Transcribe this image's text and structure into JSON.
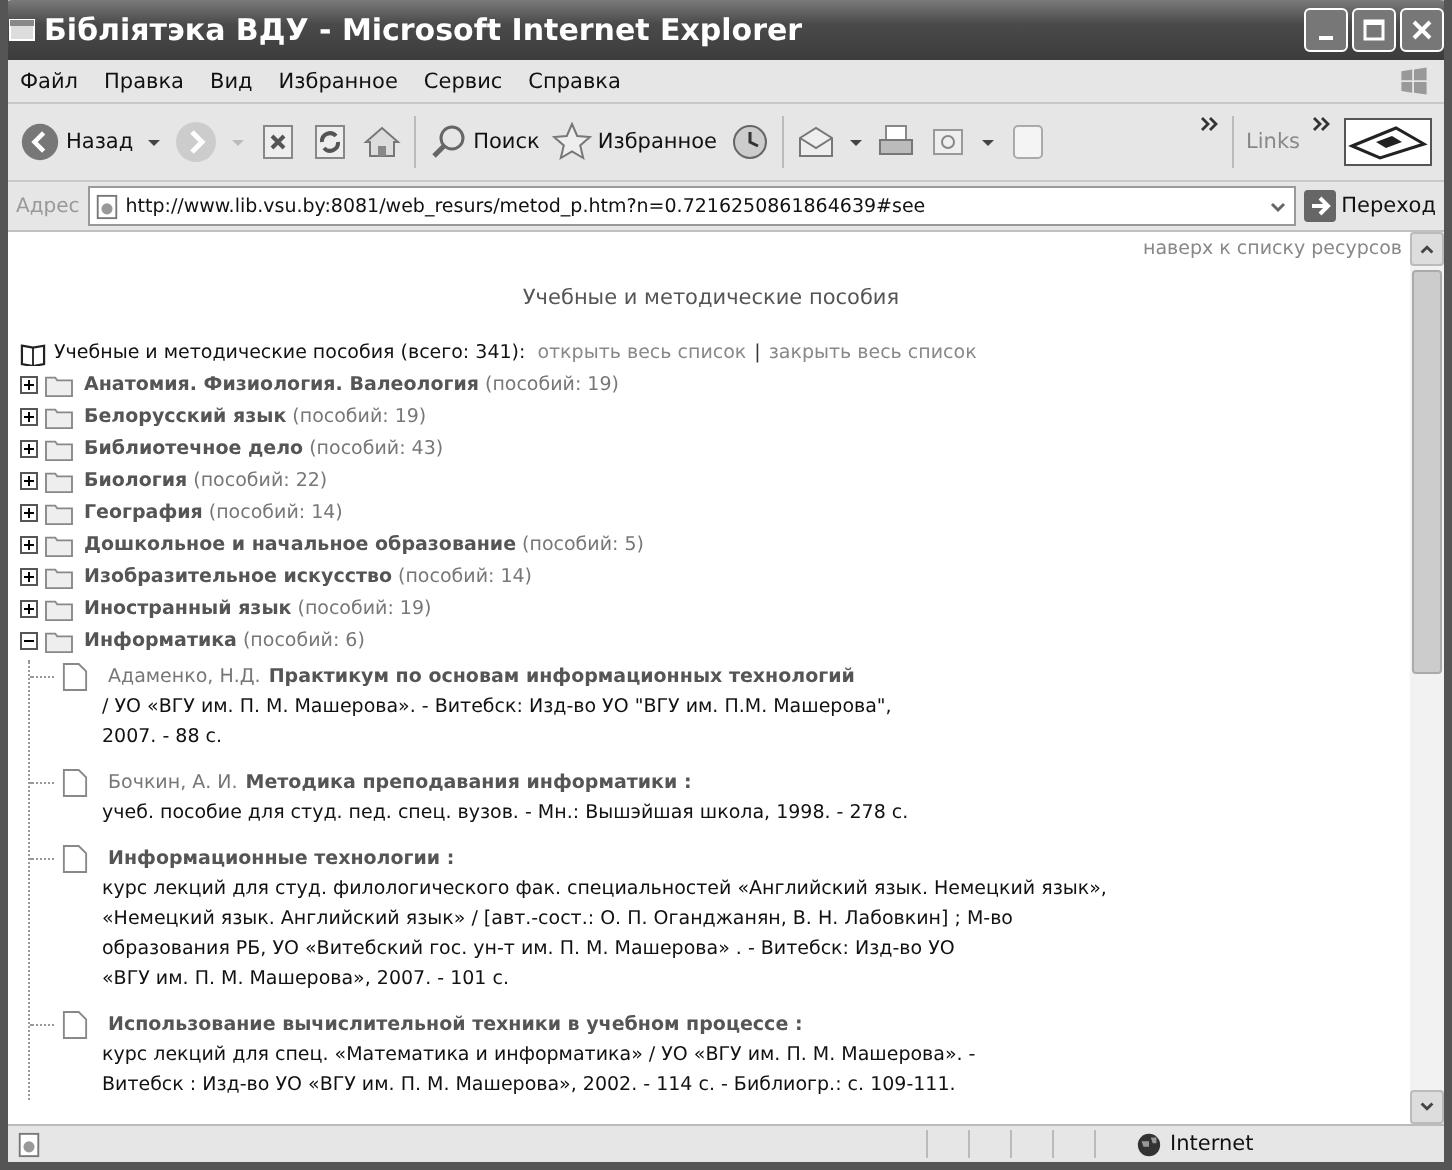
{
  "window": {
    "title": "Бібліятэка ВДУ - Microsoft Internet Explorer"
  },
  "menu": [
    "Файл",
    "Правка",
    "Вид",
    "Избранное",
    "Сервис",
    "Справка"
  ],
  "toolbar": {
    "back": "Назад",
    "search": "Поиск",
    "favorites": "Избранное",
    "links": "Links"
  },
  "address": {
    "label": "Адрес",
    "url": "http://www.lib.vsu.by:8081/web_resurs/metod_p.htm?n=0.7216250861864639#see",
    "go": "Переход"
  },
  "page": {
    "top_link": "наверх к списку ресурсов",
    "heading": "Учебные и методические пособия",
    "root": {
      "label": "Учебные и методические пособия (всего: 341):",
      "open_all": "открыть весь список",
      "separator": "|",
      "close_all": "закрыть весь список"
    },
    "categories": [
      {
        "name": "Анатомия. Физиология. Валеология",
        "count": "(пособий: 19)",
        "expanded": false
      },
      {
        "name": "Белорусский язык",
        "count": "(пособий: 19)",
        "expanded": false
      },
      {
        "name": "Библиотечное дело",
        "count": "(пособий: 43)",
        "expanded": false
      },
      {
        "name": "Биология",
        "count": "(пособий: 22)",
        "expanded": false
      },
      {
        "name": "География",
        "count": "(пособий: 14)",
        "expanded": false
      },
      {
        "name": "Дошкольное и начальное образование",
        "count": "(пособий: 5)",
        "expanded": false
      },
      {
        "name": "Изобразительное искусство",
        "count": "(пособий: 14)",
        "expanded": false
      },
      {
        "name": "Иностранный язык",
        "count": "(пособий: 19)",
        "expanded": false
      },
      {
        "name": "Информатика",
        "count": "(пособий: 6)",
        "expanded": true,
        "children": [
          {
            "author": "Адаменко, Н.Д.",
            "title": "Практикум по основам информационных технологий",
            "lines": [
              "/ УО «ВГУ им. П. М. Машерова». - Витебск: Изд-во УО \"ВГУ им. П.М. Машерова\",",
              "2007. - 88 с."
            ]
          },
          {
            "author": "Бочкин, А. И.",
            "title": "Методика преподавания информатики :",
            "lines": [
              "учеб. пособие для студ. пед. спец. вузов. - Мн.: Вышэйшая школа, 1998. - 278 с."
            ]
          },
          {
            "title": "Информационные технологии :",
            "lines": [
              "курс лекций для студ. филологического фак. специальностей «Английский язык. Немецкий язык»,",
              "«Немецкий язык. Английский язык» / [авт.-сост.: О. П. Оганджанян, В. Н. Лабовкин] ; М-во",
              "образования РБ, УО «Витебский гос. ун-т им. П. М. Машерова» . - Витебск: Изд-во УО",
              "«ВГУ им. П. М. Машерова», 2007. - 101 с."
            ]
          },
          {
            "title": "Использование вычислительной техники в учебном процессе :",
            "lines": [
              "курс лекций для спец. «Математика и информатика» / УО «ВГУ им. П. М. Машерова». -",
              "Витебск : Изд-во УО «ВГУ им. П. М. Машерова», 2002. - 114 с. - Библиогр.: с. 109-111."
            ]
          }
        ]
      }
    ]
  },
  "status_bar": {
    "zone": "Internet"
  }
}
